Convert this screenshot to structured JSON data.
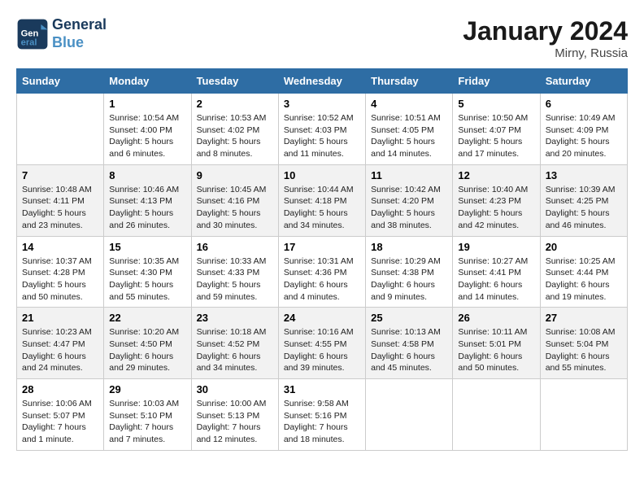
{
  "header": {
    "logo_line1": "General",
    "logo_line2": "Blue",
    "month": "January 2024",
    "location": "Mirny, Russia"
  },
  "days_of_week": [
    "Sunday",
    "Monday",
    "Tuesday",
    "Wednesday",
    "Thursday",
    "Friday",
    "Saturday"
  ],
  "weeks": [
    [
      {
        "num": "",
        "detail": ""
      },
      {
        "num": "1",
        "detail": "Sunrise: 10:54 AM\nSunset: 4:00 PM\nDaylight: 5 hours\nand 6 minutes."
      },
      {
        "num": "2",
        "detail": "Sunrise: 10:53 AM\nSunset: 4:02 PM\nDaylight: 5 hours\nand 8 minutes."
      },
      {
        "num": "3",
        "detail": "Sunrise: 10:52 AM\nSunset: 4:03 PM\nDaylight: 5 hours\nand 11 minutes."
      },
      {
        "num": "4",
        "detail": "Sunrise: 10:51 AM\nSunset: 4:05 PM\nDaylight: 5 hours\nand 14 minutes."
      },
      {
        "num": "5",
        "detail": "Sunrise: 10:50 AM\nSunset: 4:07 PM\nDaylight: 5 hours\nand 17 minutes."
      },
      {
        "num": "6",
        "detail": "Sunrise: 10:49 AM\nSunset: 4:09 PM\nDaylight: 5 hours\nand 20 minutes."
      }
    ],
    [
      {
        "num": "7",
        "detail": "Sunrise: 10:48 AM\nSunset: 4:11 PM\nDaylight: 5 hours\nand 23 minutes."
      },
      {
        "num": "8",
        "detail": "Sunrise: 10:46 AM\nSunset: 4:13 PM\nDaylight: 5 hours\nand 26 minutes."
      },
      {
        "num": "9",
        "detail": "Sunrise: 10:45 AM\nSunset: 4:16 PM\nDaylight: 5 hours\nand 30 minutes."
      },
      {
        "num": "10",
        "detail": "Sunrise: 10:44 AM\nSunset: 4:18 PM\nDaylight: 5 hours\nand 34 minutes."
      },
      {
        "num": "11",
        "detail": "Sunrise: 10:42 AM\nSunset: 4:20 PM\nDaylight: 5 hours\nand 38 minutes."
      },
      {
        "num": "12",
        "detail": "Sunrise: 10:40 AM\nSunset: 4:23 PM\nDaylight: 5 hours\nand 42 minutes."
      },
      {
        "num": "13",
        "detail": "Sunrise: 10:39 AM\nSunset: 4:25 PM\nDaylight: 5 hours\nand 46 minutes."
      }
    ],
    [
      {
        "num": "14",
        "detail": "Sunrise: 10:37 AM\nSunset: 4:28 PM\nDaylight: 5 hours\nand 50 minutes."
      },
      {
        "num": "15",
        "detail": "Sunrise: 10:35 AM\nSunset: 4:30 PM\nDaylight: 5 hours\nand 55 minutes."
      },
      {
        "num": "16",
        "detail": "Sunrise: 10:33 AM\nSunset: 4:33 PM\nDaylight: 5 hours\nand 59 minutes."
      },
      {
        "num": "17",
        "detail": "Sunrise: 10:31 AM\nSunset: 4:36 PM\nDaylight: 6 hours\nand 4 minutes."
      },
      {
        "num": "18",
        "detail": "Sunrise: 10:29 AM\nSunset: 4:38 PM\nDaylight: 6 hours\nand 9 minutes."
      },
      {
        "num": "19",
        "detail": "Sunrise: 10:27 AM\nSunset: 4:41 PM\nDaylight: 6 hours\nand 14 minutes."
      },
      {
        "num": "20",
        "detail": "Sunrise: 10:25 AM\nSunset: 4:44 PM\nDaylight: 6 hours\nand 19 minutes."
      }
    ],
    [
      {
        "num": "21",
        "detail": "Sunrise: 10:23 AM\nSunset: 4:47 PM\nDaylight: 6 hours\nand 24 minutes."
      },
      {
        "num": "22",
        "detail": "Sunrise: 10:20 AM\nSunset: 4:50 PM\nDaylight: 6 hours\nand 29 minutes."
      },
      {
        "num": "23",
        "detail": "Sunrise: 10:18 AM\nSunset: 4:52 PM\nDaylight: 6 hours\nand 34 minutes."
      },
      {
        "num": "24",
        "detail": "Sunrise: 10:16 AM\nSunset: 4:55 PM\nDaylight: 6 hours\nand 39 minutes."
      },
      {
        "num": "25",
        "detail": "Sunrise: 10:13 AM\nSunset: 4:58 PM\nDaylight: 6 hours\nand 45 minutes."
      },
      {
        "num": "26",
        "detail": "Sunrise: 10:11 AM\nSunset: 5:01 PM\nDaylight: 6 hours\nand 50 minutes."
      },
      {
        "num": "27",
        "detail": "Sunrise: 10:08 AM\nSunset: 5:04 PM\nDaylight: 6 hours\nand 55 minutes."
      }
    ],
    [
      {
        "num": "28",
        "detail": "Sunrise: 10:06 AM\nSunset: 5:07 PM\nDaylight: 7 hours\nand 1 minute."
      },
      {
        "num": "29",
        "detail": "Sunrise: 10:03 AM\nSunset: 5:10 PM\nDaylight: 7 hours\nand 7 minutes."
      },
      {
        "num": "30",
        "detail": "Sunrise: 10:00 AM\nSunset: 5:13 PM\nDaylight: 7 hours\nand 12 minutes."
      },
      {
        "num": "31",
        "detail": "Sunrise: 9:58 AM\nSunset: 5:16 PM\nDaylight: 7 hours\nand 18 minutes."
      },
      {
        "num": "",
        "detail": ""
      },
      {
        "num": "",
        "detail": ""
      },
      {
        "num": "",
        "detail": ""
      }
    ]
  ]
}
